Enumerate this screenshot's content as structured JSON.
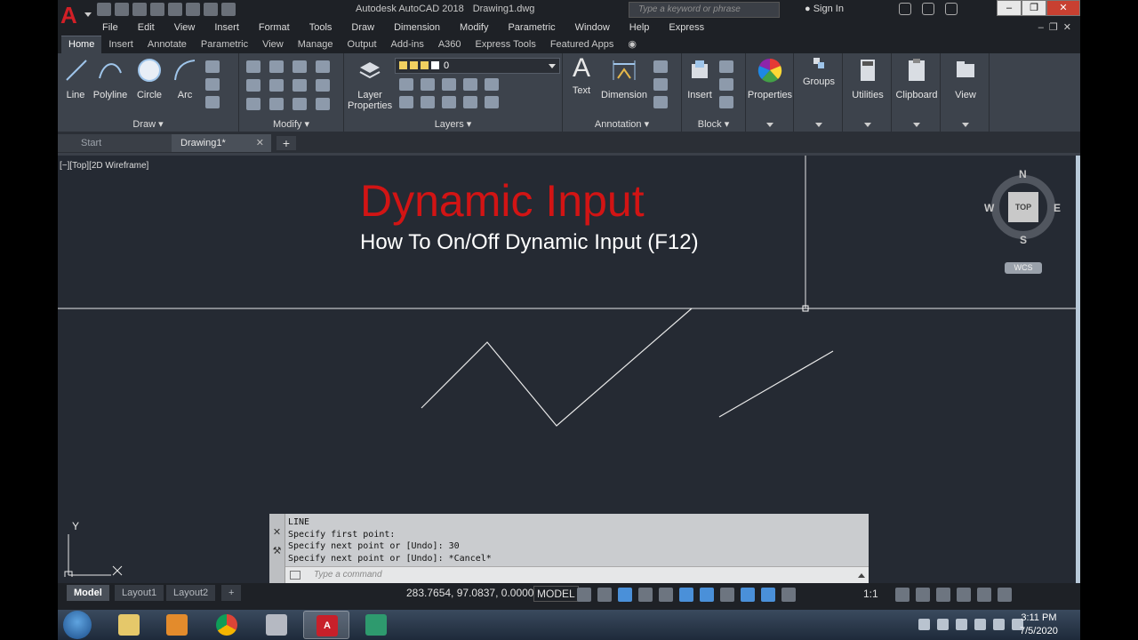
{
  "window": {
    "app_name": "Autodesk AutoCAD 2018",
    "document": "Drawing1.dwg",
    "search_placeholder": "Type a keyword or phrase",
    "sign_in": "Sign In"
  },
  "menu": [
    "File",
    "Edit",
    "View",
    "Insert",
    "Format",
    "Tools",
    "Draw",
    "Dimension",
    "Modify",
    "Parametric",
    "Window",
    "Help",
    "Express"
  ],
  "ribbon_tabs": [
    "Home",
    "Insert",
    "Annotate",
    "Parametric",
    "View",
    "Manage",
    "Output",
    "Add-ins",
    "A360",
    "Express Tools",
    "Featured Apps"
  ],
  "ribbon": {
    "draw": {
      "title": "Draw",
      "line": "Line",
      "polyline": "Polyline",
      "circle": "Circle",
      "arc": "Arc"
    },
    "modify": {
      "title": "Modify"
    },
    "layers": {
      "title": "Layers",
      "layer_properties": "Layer Properties",
      "current_layer": "0"
    },
    "annotation": {
      "title": "Annotation",
      "text": "Text",
      "dimension": "Dimension"
    },
    "block": {
      "title": "Block",
      "insert": "Insert"
    },
    "properties": "Properties",
    "groups": "Groups",
    "utilities": "Utilities",
    "clipboard": "Clipboard",
    "view": "View"
  },
  "file_tabs": {
    "start": "Start",
    "drawing": "Drawing1*"
  },
  "viewport": {
    "label": "[−][Top][2D Wireframe]",
    "overlay_title": "Dynamic Input",
    "overlay_subtitle": "How To On/Off Dynamic Input (F12)",
    "viewcube": {
      "n": "N",
      "s": "S",
      "e": "E",
      "w": "W",
      "face": "TOP",
      "wcs": "WCS"
    },
    "ucs": {
      "y": "Y"
    }
  },
  "command": {
    "history": [
      "LINE",
      "Specify first point:",
      "Specify next point or [Undo]: 30",
      "Specify next point or [Undo]: *Cancel*"
    ],
    "placeholder": "Type a command"
  },
  "layout_tabs": [
    "Model",
    "Layout1",
    "Layout2"
  ],
  "status": {
    "coords": "283.7654, 97.0837, 0.0000",
    "space": "MODEL",
    "scale": "1:1"
  },
  "taskbar": {
    "time": "3:11 PM",
    "date": "7/5/2020"
  },
  "colors": {
    "accent_red": "#d21f26",
    "viewport_bg": "#252a33",
    "ribbon_bg": "#3d434c"
  }
}
